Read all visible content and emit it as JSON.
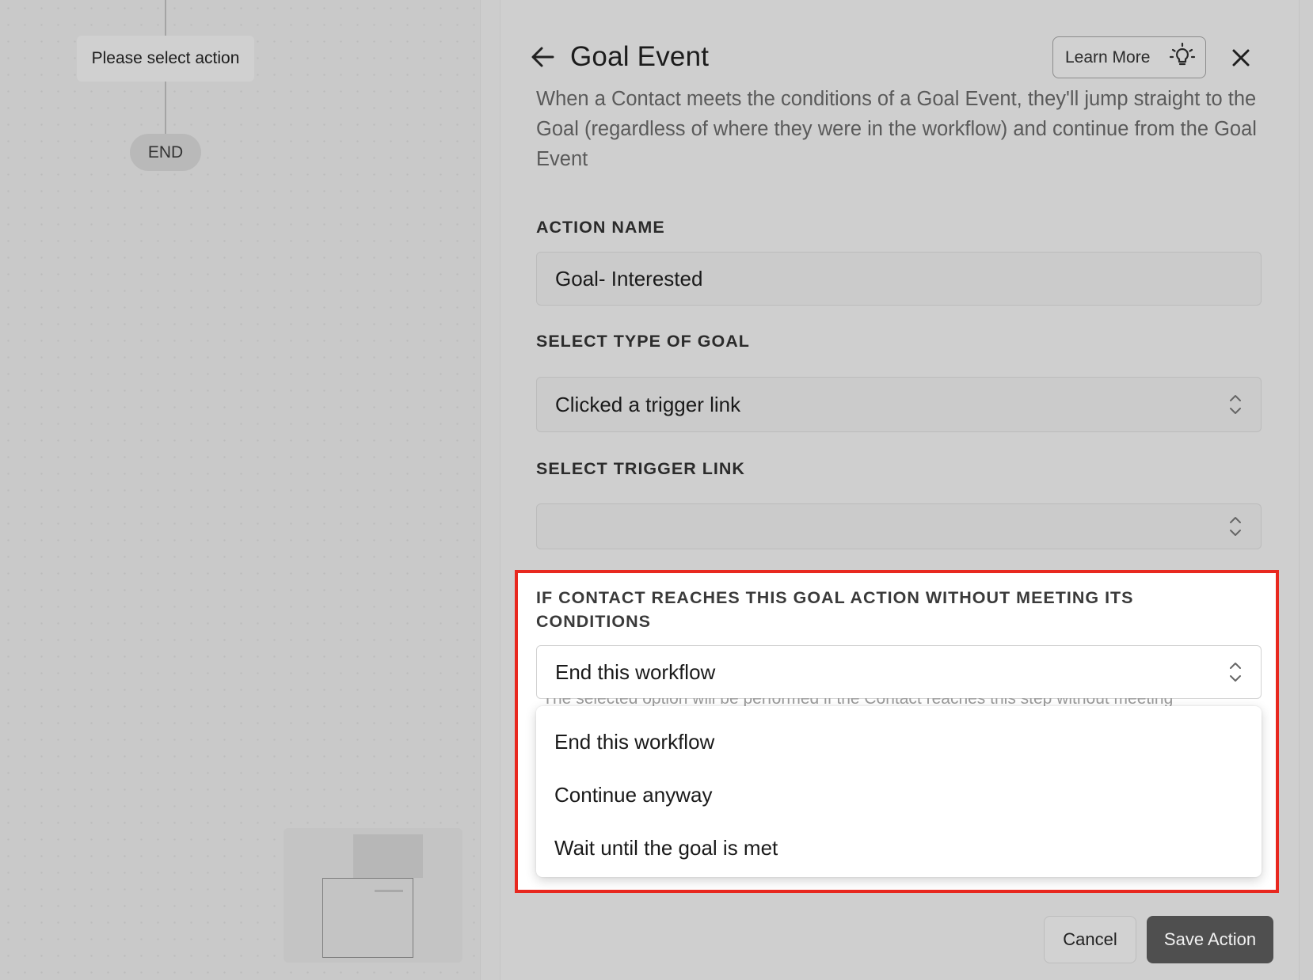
{
  "canvas": {
    "action_node_label": "Please select action",
    "end_node_label": "END"
  },
  "panel": {
    "title": "Goal Event",
    "learn_more_label": "Learn More",
    "description": "When a Contact meets the conditions of a Goal Event, they'll jump straight to the Goal (regardless of where they were in the workflow) and continue from the Goal Event",
    "fields": {
      "action_name": {
        "label": "ACTION NAME",
        "value": "Goal- Interested"
      },
      "goal_type": {
        "label": "SELECT TYPE OF GOAL",
        "value": "Clicked a trigger link"
      },
      "trigger_link": {
        "label": "SELECT TRIGGER LINK",
        "value": ""
      },
      "fallback": {
        "label": "IF CONTACT REACHES THIS GOAL ACTION WITHOUT MEETING ITS CONDITIONS",
        "value": "End this workflow",
        "helper_text": "*The selected option will be performed if the Contact reaches this step without meeting",
        "options": [
          "End this workflow",
          "Continue anyway",
          "Wait until the goal is met"
        ]
      }
    },
    "footer": {
      "cancel_label": "Cancel",
      "save_label": "Save Action"
    }
  },
  "colors": {
    "highlight": "#e8281f",
    "save_button": "#4f4f4f"
  }
}
